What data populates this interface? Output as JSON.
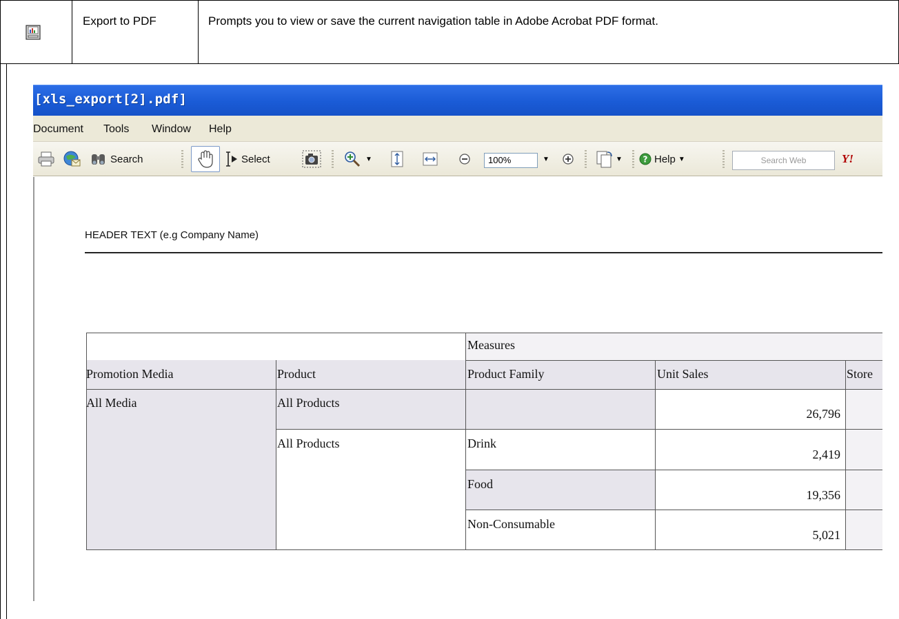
{
  "doc_row": {
    "feature_name": "Export to PDF",
    "description": "Prompts you to view or save the current navigation table in Adobe Acrobat PDF format."
  },
  "window": {
    "title": "[xls_export[2].pdf]"
  },
  "menu": [
    "Document",
    "Tools",
    "Window",
    "Help"
  ],
  "toolbar": {
    "search_label": "Search",
    "select_label": "Select",
    "zoom_value": "100%",
    "help_label": "Help",
    "search_web_placeholder": "Search Web",
    "yahoo_label": "Y!"
  },
  "page": {
    "header_text": "HEADER TEXT (e.g Company Name)"
  },
  "report": {
    "measures_label": "Measures",
    "columns": [
      "Promotion Media",
      "Product",
      "Product Family",
      "Unit Sales",
      "Store"
    ],
    "rows": {
      "media": "All Media",
      "product_total": "All Products",
      "product_total_value": "26,796",
      "product_group": "All Products",
      "families": [
        {
          "name": "Drink",
          "unit_sales": "2,419"
        },
        {
          "name": "Food",
          "unit_sales": "19,356"
        },
        {
          "name": "Non-Consumable",
          "unit_sales": "5,021"
        }
      ]
    }
  }
}
